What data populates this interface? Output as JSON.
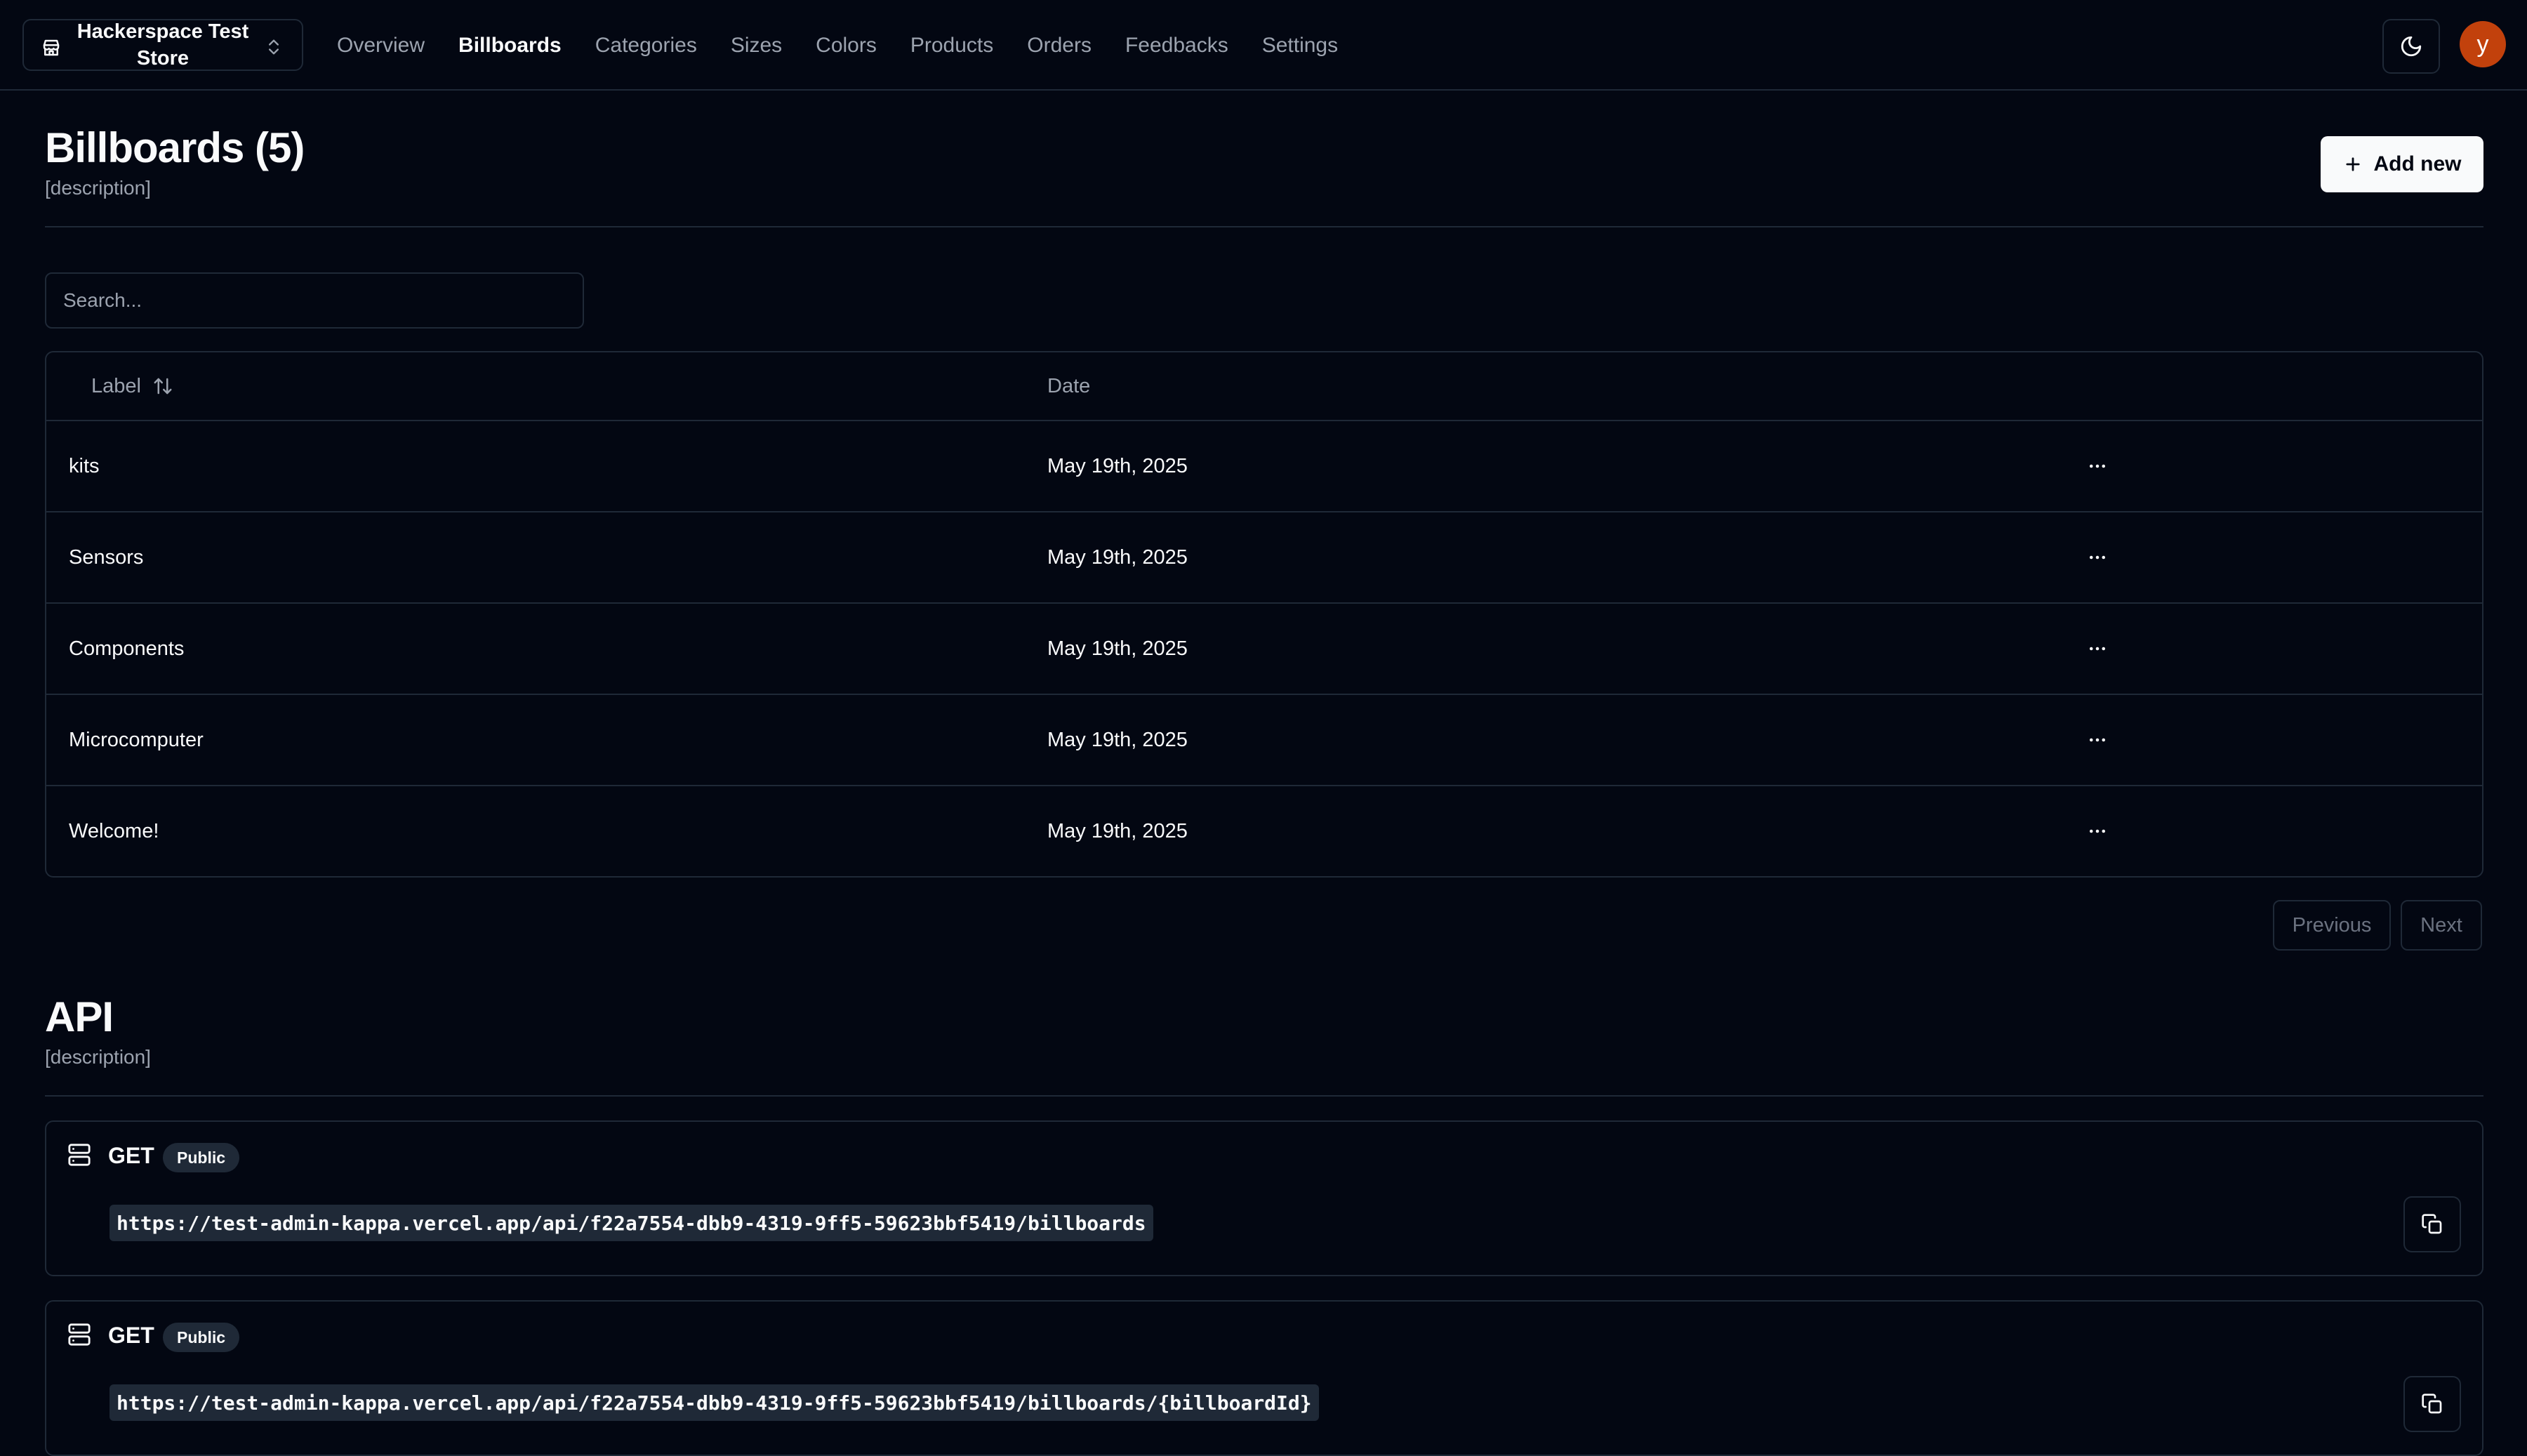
{
  "header": {
    "store_name": "Hackerspace Test Store",
    "nav": [
      "Overview",
      "Billboards",
      "Categories",
      "Sizes",
      "Colors",
      "Products",
      "Orders",
      "Feedbacks",
      "Settings"
    ],
    "active_nav": "Billboards",
    "avatar_initial": "y"
  },
  "billboards": {
    "title": "Billboards (5)",
    "description": "[description]",
    "add_label": "Add new",
    "search_placeholder": "Search...",
    "columns": {
      "label": "Label",
      "date": "Date"
    },
    "rows": [
      {
        "label": "kits",
        "date": "May 19th, 2025"
      },
      {
        "label": "Sensors",
        "date": "May 19th, 2025"
      },
      {
        "label": "Components",
        "date": "May 19th, 2025"
      },
      {
        "label": "Microcomputer",
        "date": "May 19th, 2025"
      },
      {
        "label": "Welcome!",
        "date": "May 19th, 2025"
      }
    ],
    "pagination": {
      "previous": "Previous",
      "next": "Next"
    }
  },
  "api": {
    "title": "API",
    "description": "[description]",
    "endpoints": [
      {
        "method": "GET",
        "badge": "Public",
        "url": "https://test-admin-kappa.vercel.app/api/f22a7554-dbb9-4319-9ff5-59623bbf5419/billboards"
      },
      {
        "method": "GET",
        "badge": "Public",
        "url": "https://test-admin-kappa.vercel.app/api/f22a7554-dbb9-4319-9ff5-59623bbf5419/billboards/{billboardId}"
      }
    ]
  },
  "colors": {
    "background": "#030712",
    "border": "#1f2937",
    "avatar": "#c2410c"
  }
}
